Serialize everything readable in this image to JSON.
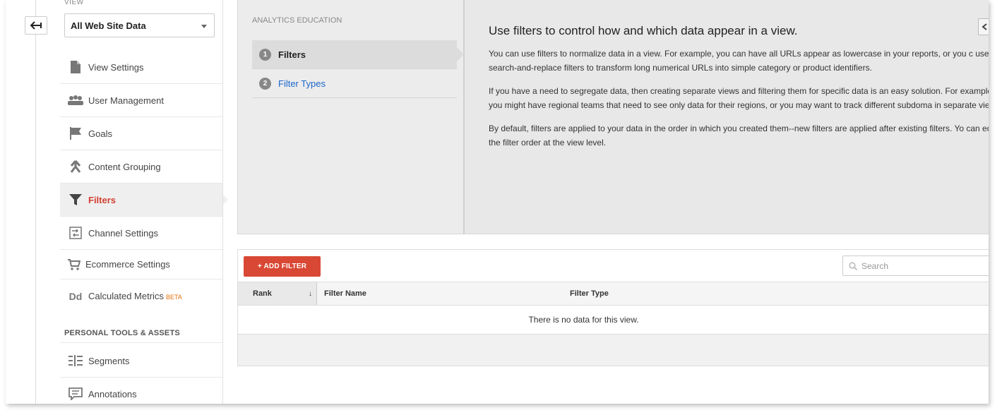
{
  "header": {
    "view_label": "VIEW",
    "view_select_value": "All Web Site Data"
  },
  "nav": {
    "items": [
      {
        "label": "View Settings",
        "icon": "document-icon"
      },
      {
        "label": "User Management",
        "icon": "users-icon"
      },
      {
        "label": "Goals",
        "icon": "flag-icon"
      },
      {
        "label": "Content Grouping",
        "icon": "grouping-icon"
      },
      {
        "label": "Filters",
        "icon": "filter-icon",
        "active": true
      },
      {
        "label": "Channel Settings",
        "icon": "channel-icon"
      },
      {
        "label": "Ecommerce Settings",
        "icon": "cart-icon"
      },
      {
        "label": "Calculated Metrics",
        "icon": "dd-icon",
        "badge": "BETA"
      }
    ],
    "section_header": "PERSONAL TOOLS & ASSETS",
    "tools": [
      {
        "label": "Segments",
        "icon": "segments-icon"
      },
      {
        "label": "Annotations",
        "icon": "annotations-icon"
      }
    ],
    "active_color": "#d23f31"
  },
  "education": {
    "title": "ANALYTICS EDUCATION",
    "steps": [
      {
        "num": "1",
        "label": "Filters"
      },
      {
        "num": "2",
        "label": "Filter Types"
      }
    ],
    "heading": "Use filters to control how and which data appear in a view.",
    "paragraphs": [
      "You can use filters to normalize data in a view. For example, you can have all URLs appear as lowercase in your reports, or you c use search-and-replace filters to transform long numerical URLs into simple category or product identifiers.",
      "If you have a need to segregate data, then creating separate views and filtering them for specific data is an easy solution. For example, you might have regional teams that need to see only data for their regions, or you may want to track different subdoma in separate views.",
      "By default, filters are applied to your data in the order in which you created them--new filters are applied after existing filters. Yo can edit the filter order at the view level."
    ]
  },
  "table": {
    "add_button": "+ ADD FILTER",
    "search_placeholder": "Search",
    "columns": [
      "Rank",
      "Filter Name",
      "Filter Type"
    ],
    "empty_message": "There is no data for this view."
  },
  "colors": {
    "accent_red": "#d94835",
    "link_blue": "#1a66cc"
  }
}
